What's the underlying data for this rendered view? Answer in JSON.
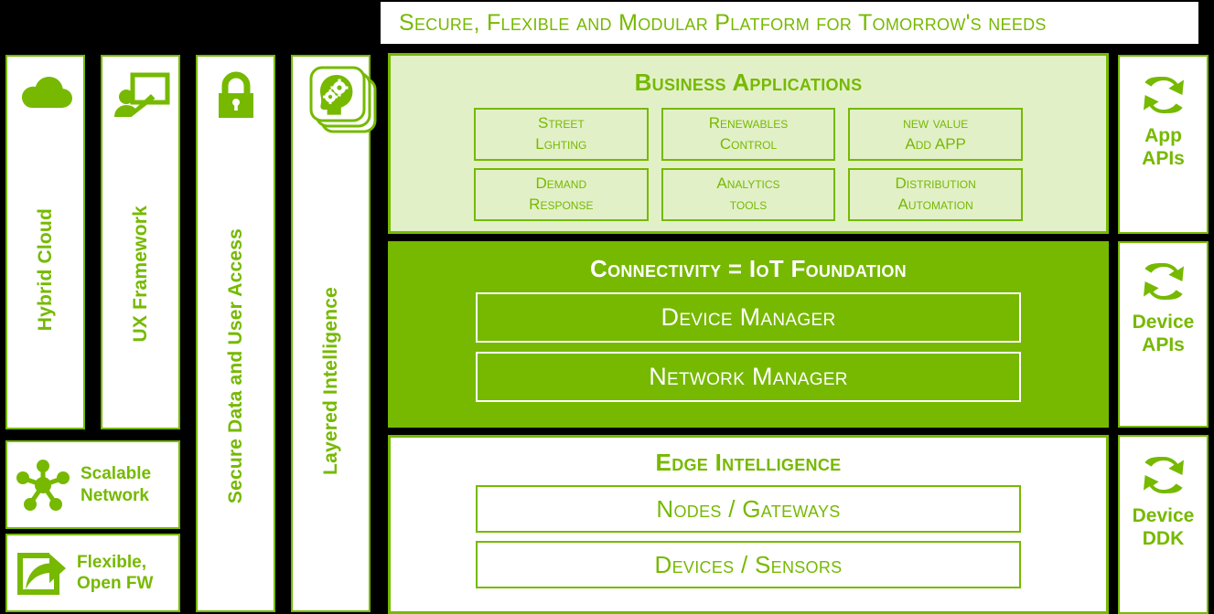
{
  "header": {
    "title": "Secure, Flexible and Modular Platform for Tomorrow's needs"
  },
  "colors": {
    "brand_green": "#76b900",
    "light_green": "#e2f0c8",
    "background": "#000000",
    "white": "#ffffff"
  },
  "left_columns": [
    {
      "label": "Hybrid Cloud",
      "icon": "cloud-icon"
    },
    {
      "label": "UX Framework",
      "icon": "presentation-person-icon"
    },
    {
      "label": "Secure Data and User Access",
      "icon": "padlock-icon"
    },
    {
      "label": "Layered Intelligence",
      "icon": "head-with-gears-stack-icon"
    }
  ],
  "left_cards": [
    {
      "label_line1": "Scalable",
      "label_line2": "Network",
      "icon": "network-hub-icon"
    },
    {
      "label_line1": "Flexible,",
      "label_line2": "Open FW",
      "icon": "export-arrow-icon"
    }
  ],
  "main": {
    "business_applications": {
      "heading": "Business Applications",
      "tiles": [
        {
          "line1": "Street",
          "line2": "Lghting"
        },
        {
          "line1": "Renewables",
          "line2": "Control"
        },
        {
          "line1": "new value",
          "line2": "Add APP"
        },
        {
          "line1": "Demand",
          "line2": "Response"
        },
        {
          "line1": "Analytics",
          "line2": "tools"
        },
        {
          "line1": "Distribution",
          "line2": "Automation"
        }
      ]
    },
    "connectivity": {
      "heading": "Connectivity = IoT Foundation",
      "tiles": [
        {
          "label": "Device Manager"
        },
        {
          "label": "Network Manager"
        }
      ]
    },
    "edge": {
      "heading": "Edge Intelligence",
      "tiles": [
        {
          "label": "Nodes / Gateways"
        },
        {
          "label": "Devices / Sensors"
        }
      ]
    }
  },
  "right_panels": [
    {
      "line1": "App",
      "line2": "APIs",
      "icon": "sync-arrows-icon"
    },
    {
      "line1": "Device",
      "line2": "APIs",
      "icon": "sync-arrows-icon"
    },
    {
      "line1": "Device",
      "line2": "DDK",
      "icon": "sync-arrows-icon"
    }
  ]
}
